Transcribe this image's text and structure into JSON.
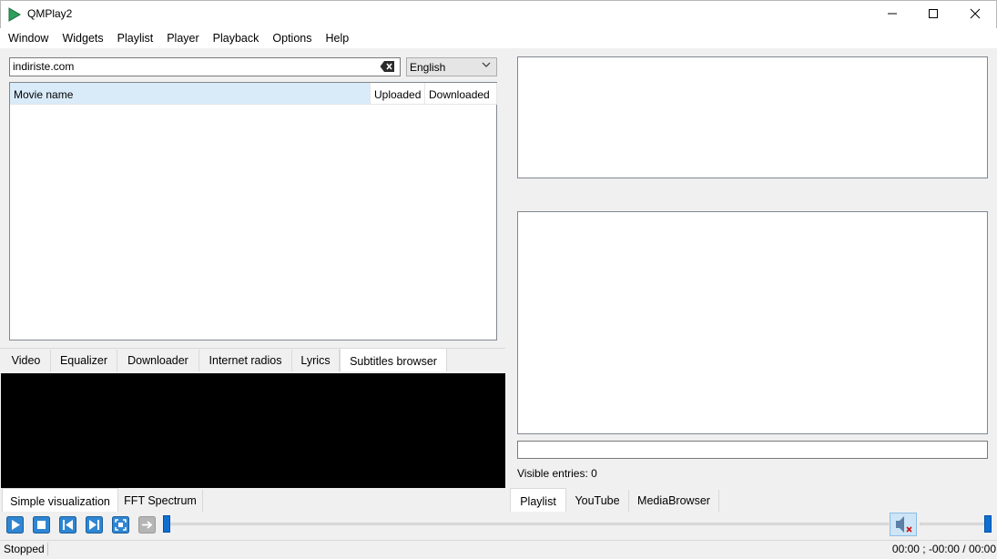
{
  "window": {
    "title": "QMPlay2"
  },
  "menu": [
    "Window",
    "Widgets",
    "Playlist",
    "Player",
    "Playback",
    "Options",
    "Help"
  ],
  "subtitles": {
    "search_value": "indiriste.com",
    "language": "English",
    "columns": [
      "Movie name",
      "Uploaded",
      "Downloaded"
    ]
  },
  "top_tabs": [
    "Video",
    "Equalizer",
    "Downloader",
    "Internet radios",
    "Lyrics",
    "Subtitles browser"
  ],
  "vis_tabs": [
    "Simple visualization",
    "FFT Spectrum"
  ],
  "right_pane": {
    "visible_entries": "Visible entries: 0",
    "tabs": [
      "Playlist",
      "YouTube",
      "MediaBrowser"
    ]
  },
  "status": {
    "state": "Stopped",
    "time": "00:00 ; -00:00 / 00:00"
  },
  "colors": {
    "accent": "#0f6fd1",
    "header_selected": "#d9ebf9",
    "vis_bg": "#000000"
  }
}
